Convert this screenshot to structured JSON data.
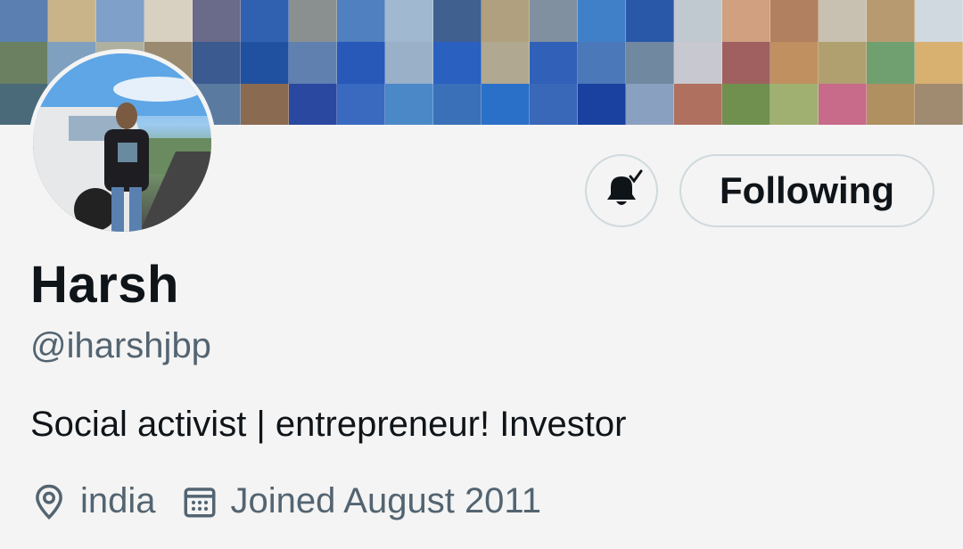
{
  "profile": {
    "name": "Harsh",
    "handle": "@iharshjbp",
    "bio": "Social activist | entrepreneur! Investor",
    "location": "india",
    "joined": "Joined August 2011"
  },
  "actions": {
    "notification_icon": "bell-check-icon",
    "follow_label": "Following"
  },
  "colors": {
    "background": "#f4f4f4",
    "text_primary": "#0f1419",
    "text_secondary": "#536471",
    "button_border": "#cfd9de"
  }
}
